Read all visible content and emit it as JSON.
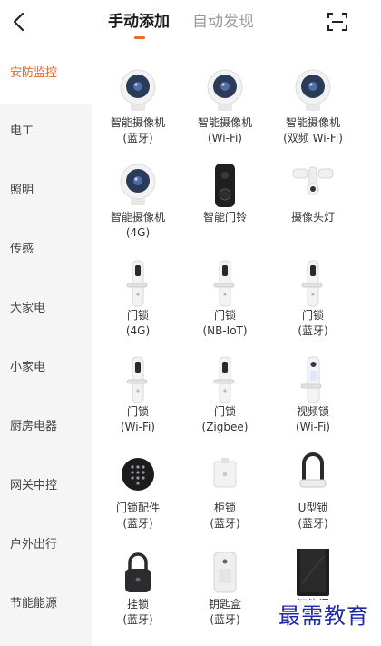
{
  "header": {
    "tab_manual": "手动添加",
    "tab_auto": "自动发现"
  },
  "sidebar": {
    "items": [
      {
        "label": "安防监控"
      },
      {
        "label": "电工"
      },
      {
        "label": "照明"
      },
      {
        "label": "传感"
      },
      {
        "label": "大家电"
      },
      {
        "label": "小家电"
      },
      {
        "label": "厨房电器"
      },
      {
        "label": "网关中控"
      },
      {
        "label": "户外出行"
      },
      {
        "label": "节能能源"
      }
    ]
  },
  "products": [
    {
      "name": "智能摄像机",
      "sub": "(蓝牙)",
      "icon": "camera-icon"
    },
    {
      "name": "智能摄像机",
      "sub": "(Wi-Fi)",
      "icon": "camera-icon"
    },
    {
      "name": "智能摄像机",
      "sub": "(双频 Wi-Fi)",
      "icon": "camera-icon"
    },
    {
      "name": "智能摄像机",
      "sub": "(4G)",
      "icon": "camera-icon"
    },
    {
      "name": "智能门铃",
      "sub": "",
      "icon": "doorbell-icon"
    },
    {
      "name": "摄像头灯",
      "sub": "",
      "icon": "floodlight-camera-icon"
    },
    {
      "name": "门锁",
      "sub": "(4G)",
      "icon": "door-lock-icon"
    },
    {
      "name": "门锁",
      "sub": "(NB-IoT)",
      "icon": "door-lock-icon"
    },
    {
      "name": "门锁",
      "sub": "(蓝牙)",
      "icon": "door-lock-icon"
    },
    {
      "name": "门锁",
      "sub": "(Wi-Fi)",
      "icon": "door-lock-icon"
    },
    {
      "name": "门锁",
      "sub": "(Zigbee)",
      "icon": "door-lock-icon"
    },
    {
      "name": "视频锁",
      "sub": "(Wi-Fi)",
      "icon": "video-lock-icon"
    },
    {
      "name": "门锁配件",
      "sub": "(蓝牙)",
      "icon": "keypad-icon"
    },
    {
      "name": "柜锁",
      "sub": "(蓝牙)",
      "icon": "cabinet-lock-icon"
    },
    {
      "name": "U型锁",
      "sub": "(蓝牙)",
      "icon": "u-lock-icon"
    },
    {
      "name": "挂锁",
      "sub": "(蓝牙)",
      "icon": "padlock-icon"
    },
    {
      "name": "钥匙盒",
      "sub": "(蓝牙)",
      "icon": "key-box-icon"
    },
    {
      "name": "智能门",
      "sub": "",
      "icon": "smart-door-icon"
    }
  ],
  "watermark": "最需教育",
  "colors": {
    "accent": "#ee6a28",
    "sidebar_bg": "#f5f5f5",
    "watermark": "#1e2aa8"
  }
}
